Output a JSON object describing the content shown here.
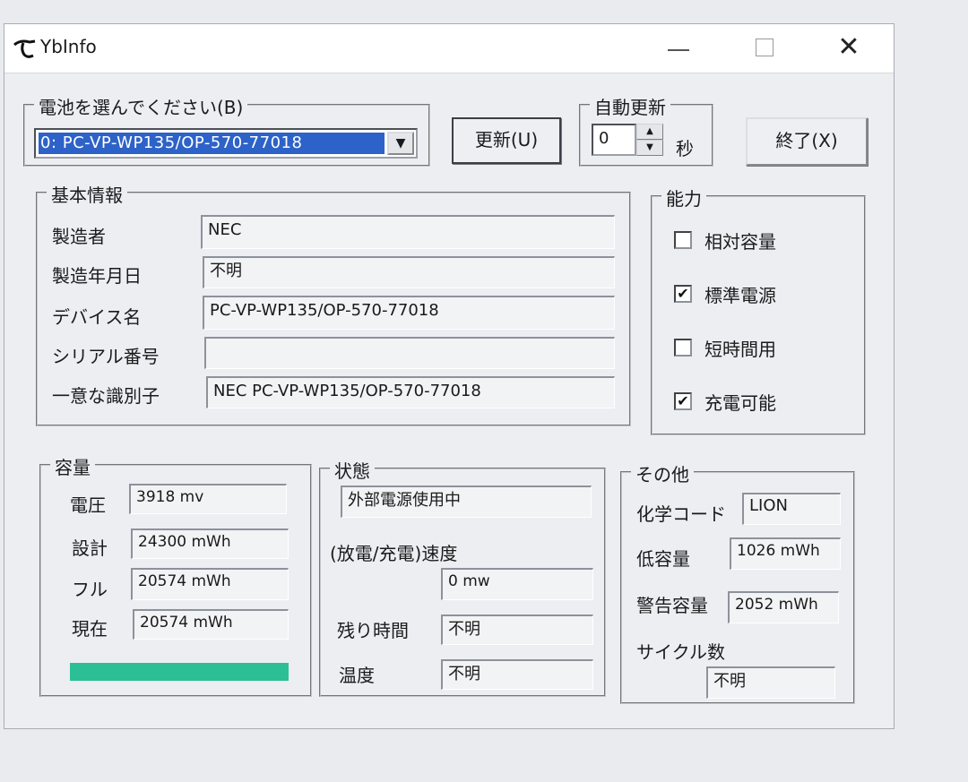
{
  "window": {
    "title": "YbInfo",
    "icon": "yb-app-icon",
    "controls": {
      "minimize": "minimize-icon",
      "maximize": "maximize-icon",
      "close": "✕"
    }
  },
  "battery_select": {
    "group_label": "電池を選んでください(B)",
    "selected": "0: PC-VP-WP135/OP-570-77018",
    "arrow": "▼"
  },
  "buttons": {
    "refresh": "更新(U)",
    "exit": "終了(X)"
  },
  "auto_refresh": {
    "group_label": "自動更新",
    "value": "0",
    "unit": "秒",
    "up": "▲",
    "down": "▼"
  },
  "basic_info": {
    "group_label": "基本情報",
    "rows": [
      {
        "label": "製造者",
        "value": "NEC"
      },
      {
        "label": "製造年月日",
        "value": "不明"
      },
      {
        "label": "デバイス名",
        "value": "PC-VP-WP135/OP-570-77018"
      },
      {
        "label": "シリアル番号",
        "value": ""
      },
      {
        "label": "一意な識別子",
        "value": "NEC  PC-VP-WP135/OP-570-77018"
      }
    ]
  },
  "capabilities": {
    "group_label": "能力",
    "items": [
      {
        "label": "相対容量",
        "checked": false,
        "mark": ""
      },
      {
        "label": "標準電源",
        "checked": true,
        "mark": "✔"
      },
      {
        "label": "短時間用",
        "checked": false,
        "mark": ""
      },
      {
        "label": "充電可能",
        "checked": true,
        "mark": "✔"
      }
    ]
  },
  "capacity": {
    "group_label": "容量",
    "rows": [
      {
        "label": "電圧",
        "value": "3918 mv"
      },
      {
        "label": "設計",
        "value": "24300 mWh"
      },
      {
        "label": "フル",
        "value": "20574 mWh"
      },
      {
        "label": "現在",
        "value": "20574 mWh"
      }
    ],
    "charge_fraction": 1.0,
    "bar_color": "#2cbf96"
  },
  "status": {
    "group_label": "状態",
    "power_state": "外部電源使用中",
    "rate_label": "(放電/充電)速度",
    "rate_value": "0 mw",
    "remaining_label": "残り時間",
    "remaining_value": "不明",
    "temp_label": "温度",
    "temp_value": "不明"
  },
  "other": {
    "group_label": "その他",
    "chem_label": "化学コード",
    "chem_value": "LION",
    "low_label": "低容量",
    "low_value": "1026 mWh",
    "warn_label": "警告容量",
    "warn_value": "2052 mWh",
    "cycle_label": "サイクル数",
    "cycle_value": "不明"
  }
}
